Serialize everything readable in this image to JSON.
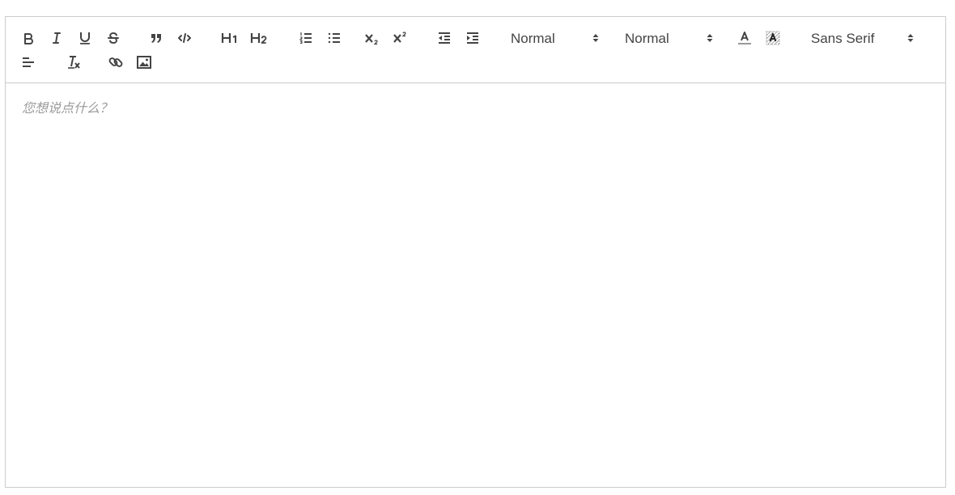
{
  "toolbar": {
    "header_picker": "Normal",
    "size_picker": "Normal",
    "font_picker": "Sans Serif",
    "buttons": [
      "bold",
      "italic",
      "underline",
      "strike",
      "blockquote",
      "code-block",
      "header-1",
      "header-2",
      "ordered-list",
      "bullet-list",
      "subscript",
      "superscript",
      "outdent",
      "indent",
      "text-color",
      "background-color",
      "align",
      "clean",
      "link",
      "image"
    ]
  },
  "editor": {
    "placeholder": "您想说点什么？"
  },
  "colors": {
    "icon": "#444444",
    "border": "#cccccc",
    "placeholder": "#9a9a9a"
  }
}
